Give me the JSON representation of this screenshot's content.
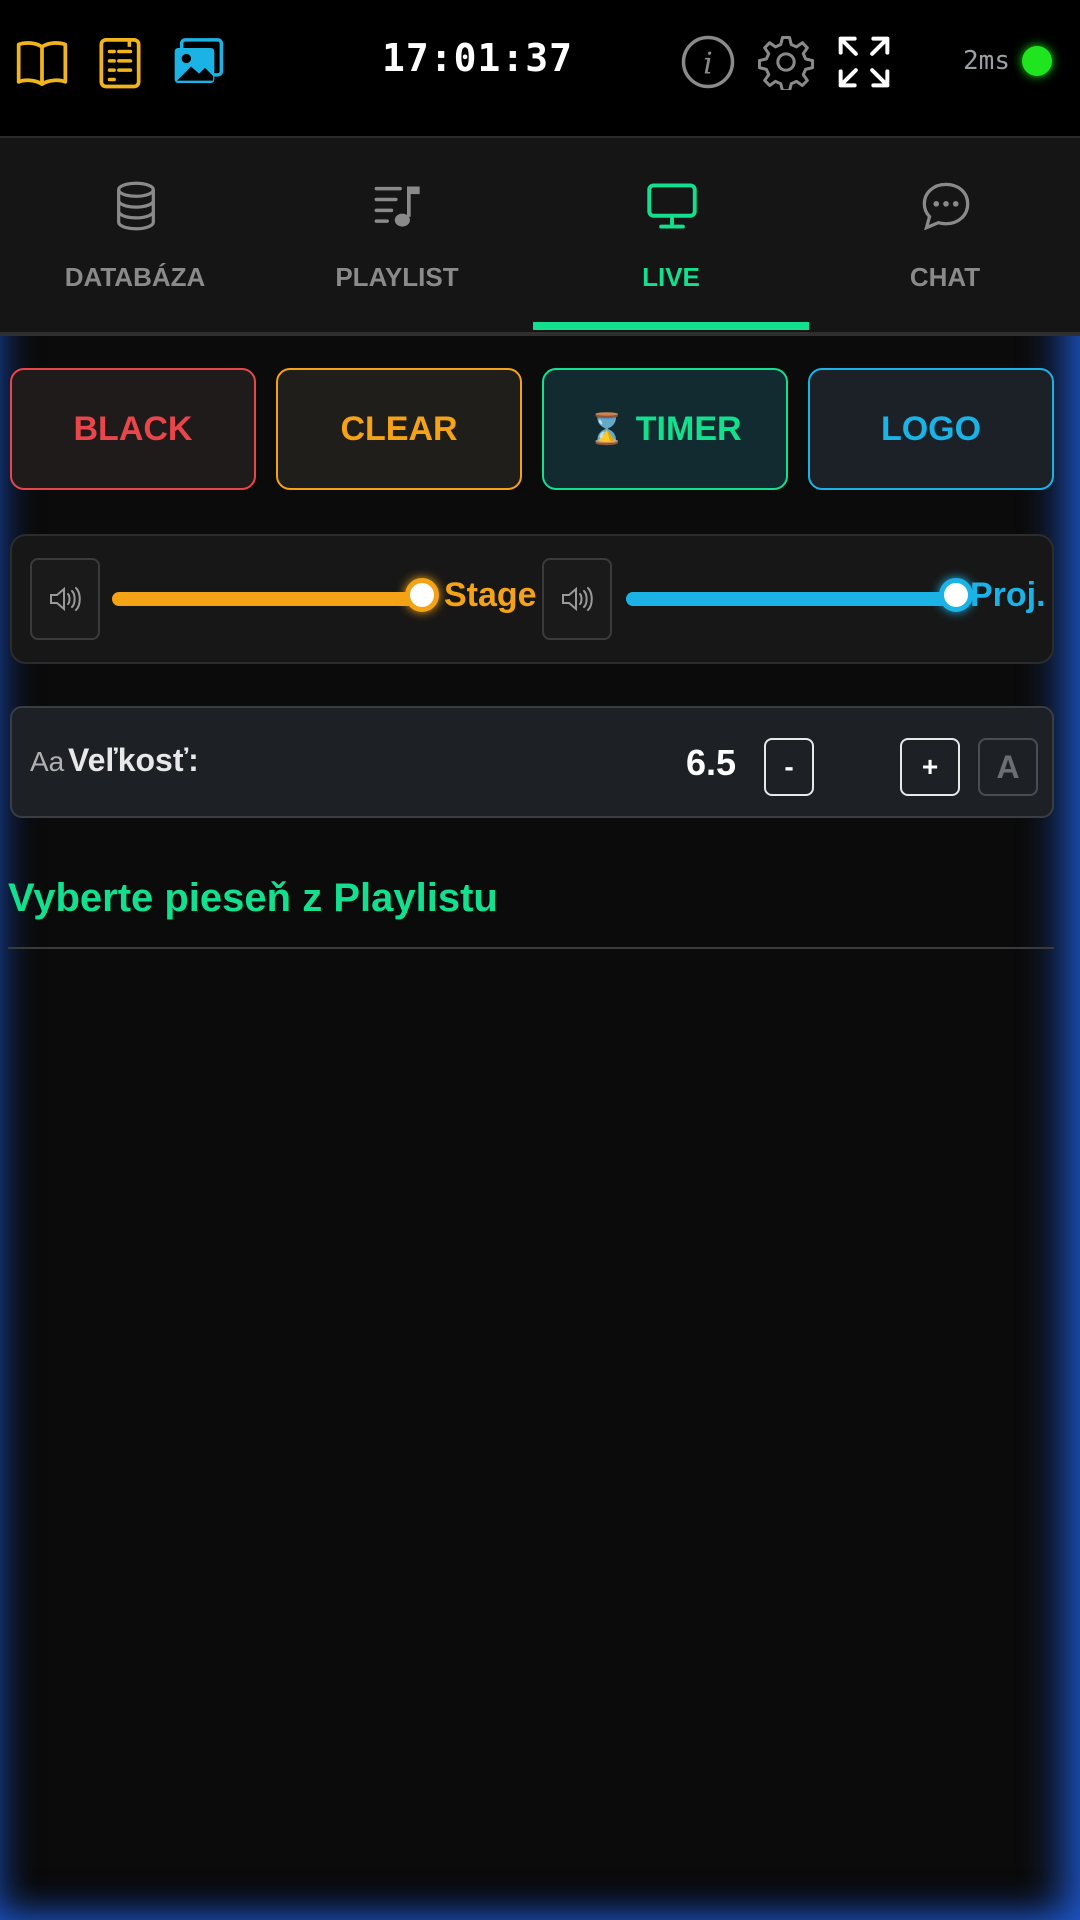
{
  "topbar": {
    "icons": [
      "book-icon",
      "document-list-icon",
      "images-icon",
      "info-icon",
      "gear-icon",
      "expand-icon"
    ],
    "clock": "17:01:37",
    "latency": "2ms",
    "status_color": "#1ee51e"
  },
  "tabs": [
    {
      "label": "DATABÁZA",
      "icon": "database-icon",
      "active": false
    },
    {
      "label": "PLAYLIST",
      "icon": "playlist-music-icon",
      "active": false
    },
    {
      "label": "LIVE",
      "icon": "monitor-icon",
      "active": true
    },
    {
      "label": "CHAT",
      "icon": "chat-bubble-icon",
      "active": false
    }
  ],
  "actions": {
    "black": "BLACK",
    "clear": "CLEAR",
    "timer": "TIMER",
    "timer_icon": "⌛",
    "logo": "LOGO"
  },
  "volume": {
    "stage_label": "Stage",
    "stage_level": 1.0,
    "proj_label": "Proj.",
    "proj_level": 1.0
  },
  "font_size": {
    "aa": "Aa",
    "label": "Veľkosť:",
    "minus": "-",
    "value": "6.5",
    "plus": "+",
    "auto": "A"
  },
  "live": {
    "prompt": "Vyberte pieseň z Playlistu"
  },
  "colors": {
    "black": "#e8464b",
    "clear": "#f4a316",
    "timer": "#13e08e",
    "logo": "#1bb3e6",
    "active_tab": "#13e08e",
    "stage": "#f4a316",
    "proj": "#1bb3e6"
  }
}
